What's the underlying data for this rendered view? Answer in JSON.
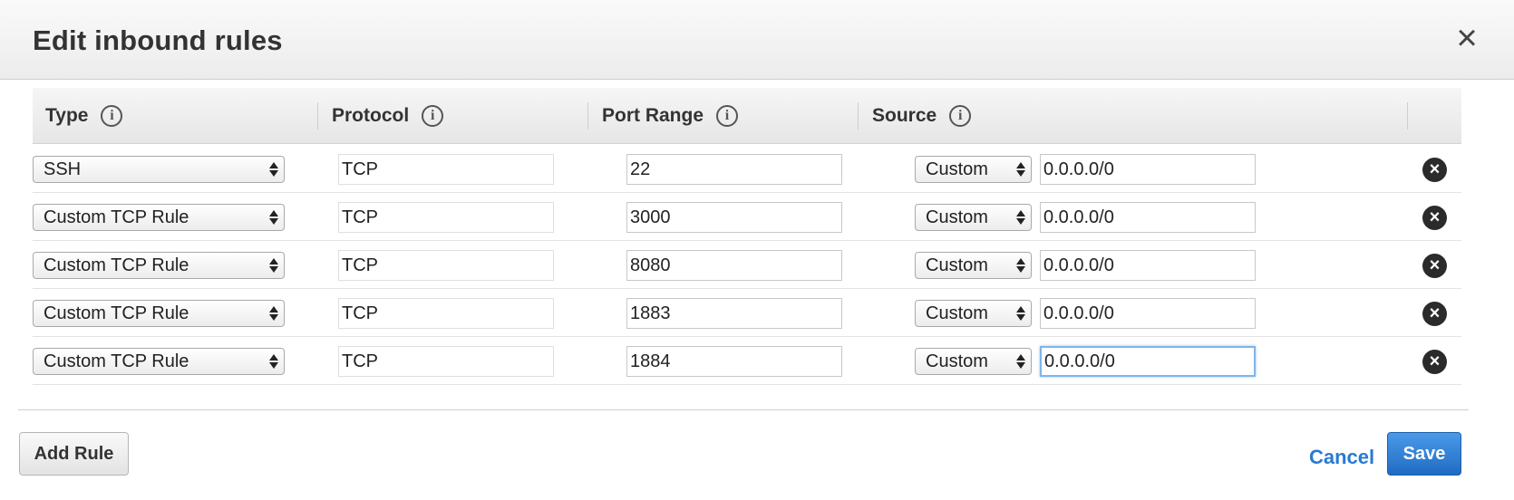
{
  "dialog": {
    "title": "Edit inbound rules",
    "close_icon": "close-icon"
  },
  "table": {
    "columns": [
      {
        "label": "Type",
        "icon": "info-icon"
      },
      {
        "label": "Protocol",
        "icon": "info-icon"
      },
      {
        "label": "Port Range",
        "icon": "info-icon"
      },
      {
        "label": "Source",
        "icon": "info-icon"
      }
    ],
    "rows": [
      {
        "type": "SSH",
        "protocol": "TCP",
        "port_range": "22",
        "source_mode": "Custom",
        "source": "0.0.0.0/0"
      },
      {
        "type": "Custom TCP Rule",
        "protocol": "TCP",
        "port_range": "3000",
        "source_mode": "Custom",
        "source": "0.0.0.0/0"
      },
      {
        "type": "Custom TCP Rule",
        "protocol": "TCP",
        "port_range": "8080",
        "source_mode": "Custom",
        "source": "0.0.0.0/0"
      },
      {
        "type": "Custom TCP Rule",
        "protocol": "TCP",
        "port_range": "1883",
        "source_mode": "Custom",
        "source": "0.0.0.0/0"
      },
      {
        "type": "Custom TCP Rule",
        "protocol": "TCP",
        "port_range": "1884",
        "source_mode": "Custom",
        "source": "0.0.0.0/0"
      }
    ]
  },
  "footer": {
    "add_rule_label": "Add Rule",
    "cancel_label": "Cancel",
    "save_label": "Save"
  },
  "colors": {
    "primary": "#1f6bc4",
    "link": "#2a7ad2",
    "focus": "#7fb4ea"
  }
}
